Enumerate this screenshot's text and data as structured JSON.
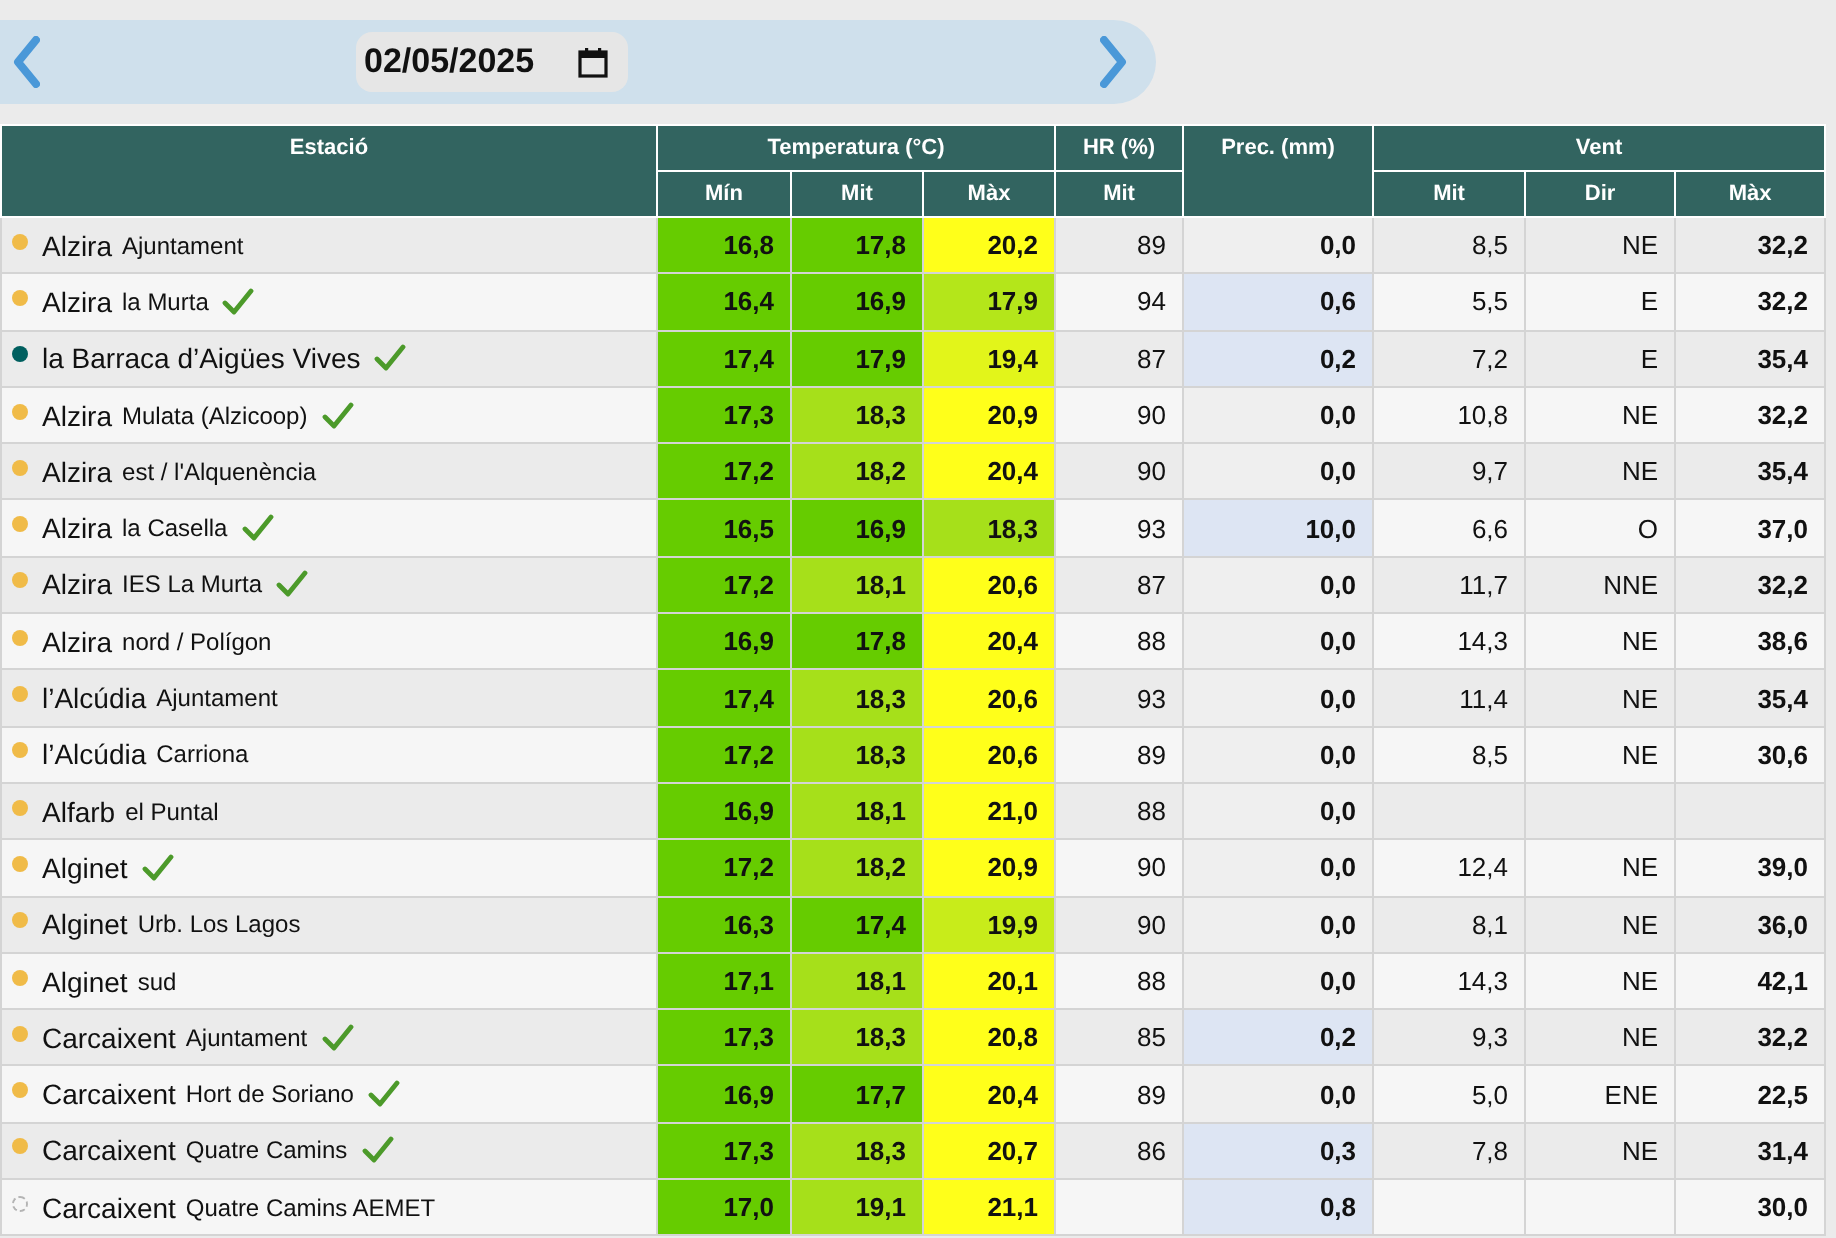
{
  "date_bar": {
    "date": "02/05/2025"
  },
  "header": {
    "station": "Estació",
    "temperature": "Temperatura (°C)",
    "temp_columns": [
      "Mín",
      "Mit",
      "Màx"
    ],
    "humidity": "HR (%)",
    "humidity_columns": [
      "Mit"
    ],
    "precipitation": "Prec. (mm)",
    "wind": "Vent",
    "wind_columns": [
      "Mit",
      "Dir",
      "Màx"
    ]
  },
  "rows": [
    {
      "town": "Alzira",
      "place": "Ajuntament",
      "color": "#f0bb48",
      "inactive": false,
      "verified": false,
      "temp": [
        {
          "value": "16,8",
          "color": "#66cc00"
        },
        {
          "value": "17,8",
          "color": "#66cc00"
        },
        {
          "value": "20,2",
          "color": "#ffff1a"
        }
      ],
      "hr": "89",
      "prec": {
        "value": "0,0",
        "highlight": false
      },
      "wind_avg": "8,5",
      "wind_dir": "NE",
      "wind_max": "32,2"
    },
    {
      "town": "Alzira",
      "place": "la Murta",
      "color": "#f0bb48",
      "inactive": false,
      "verified": true,
      "temp": [
        {
          "value": "16,4",
          "color": "#66cc00"
        },
        {
          "value": "16,9",
          "color": "#66cc00"
        },
        {
          "value": "17,9",
          "color": "#b4e61a"
        }
      ],
      "hr": "94",
      "prec": {
        "value": "0,6",
        "highlight": true
      },
      "wind_avg": "5,5",
      "wind_dir": "E",
      "wind_max": "32,2"
    },
    {
      "town": "la Barraca d’Aigües Vives",
      "color": "#005f5f",
      "inactive": false,
      "verified": true,
      "temp": [
        {
          "value": "17,4",
          "color": "#66cc00"
        },
        {
          "value": "17,9",
          "color": "#66cc00"
        },
        {
          "value": "19,4",
          "color": "#e2f51a"
        }
      ],
      "hr": "87",
      "prec": {
        "value": "0,2",
        "highlight": true
      },
      "wind_avg": "7,2",
      "wind_dir": "E",
      "wind_max": "35,4"
    },
    {
      "town": "Alzira",
      "place": "Mulata (Alzicoop)",
      "color": "#f0bb48",
      "inactive": false,
      "verified": true,
      "temp": [
        {
          "value": "17,3",
          "color": "#66cc00"
        },
        {
          "value": "18,3",
          "color": "#a6e01a"
        },
        {
          "value": "20,9",
          "color": "#ffff1a"
        }
      ],
      "hr": "90",
      "prec": {
        "value": "0,0",
        "highlight": false
      },
      "wind_avg": "10,8",
      "wind_dir": "NE",
      "wind_max": "32,2"
    },
    {
      "town": "Alzira",
      "place": "est / l'Alquenència",
      "color": "#f0bb48",
      "inactive": false,
      "verified": false,
      "temp": [
        {
          "value": "17,2",
          "color": "#66cc00"
        },
        {
          "value": "18,2",
          "color": "#a6e01a"
        },
        {
          "value": "20,4",
          "color": "#ffff1a"
        }
      ],
      "hr": "90",
      "prec": {
        "value": "0,0",
        "highlight": false
      },
      "wind_avg": "9,7",
      "wind_dir": "NE",
      "wind_max": "35,4"
    },
    {
      "town": "Alzira",
      "place": "la Casella",
      "color": "#f0bb48",
      "inactive": false,
      "verified": true,
      "temp": [
        {
          "value": "16,5",
          "color": "#66cc00"
        },
        {
          "value": "16,9",
          "color": "#66cc00"
        },
        {
          "value": "18,3",
          "color": "#a6e01a"
        }
      ],
      "hr": "93",
      "prec": {
        "value": "10,0",
        "highlight": true
      },
      "wind_avg": "6,6",
      "wind_dir": "O",
      "wind_max": "37,0"
    },
    {
      "town": "Alzira",
      "place": "IES La Murta",
      "color": "#f0bb48",
      "inactive": false,
      "verified": true,
      "temp": [
        {
          "value": "17,2",
          "color": "#66cc00"
        },
        {
          "value": "18,1",
          "color": "#a6e01a"
        },
        {
          "value": "20,6",
          "color": "#ffff1a"
        }
      ],
      "hr": "87",
      "prec": {
        "value": "0,0",
        "highlight": false
      },
      "wind_avg": "11,7",
      "wind_dir": "NNE",
      "wind_max": "32,2"
    },
    {
      "town": "Alzira",
      "place": "nord / Polígon",
      "color": "#f0bb48",
      "inactive": false,
      "verified": false,
      "temp": [
        {
          "value": "16,9",
          "color": "#66cc00"
        },
        {
          "value": "17,8",
          "color": "#66cc00"
        },
        {
          "value": "20,4",
          "color": "#ffff1a"
        }
      ],
      "hr": "88",
      "prec": {
        "value": "0,0",
        "highlight": false
      },
      "wind_avg": "14,3",
      "wind_dir": "NE",
      "wind_max": "38,6"
    },
    {
      "town": "l’Alcúdia",
      "place": "Ajuntament",
      "color": "#f0bb48",
      "inactive": false,
      "verified": false,
      "temp": [
        {
          "value": "17,4",
          "color": "#66cc00"
        },
        {
          "value": "18,3",
          "color": "#a6e01a"
        },
        {
          "value": "20,6",
          "color": "#ffff1a"
        }
      ],
      "hr": "93",
      "prec": {
        "value": "0,0",
        "highlight": false
      },
      "wind_avg": "11,4",
      "wind_dir": "NE",
      "wind_max": "35,4"
    },
    {
      "town": "l’Alcúdia",
      "place": "Carriona",
      "color": "#f0bb48",
      "inactive": false,
      "verified": false,
      "temp": [
        {
          "value": "17,2",
          "color": "#66cc00"
        },
        {
          "value": "18,3",
          "color": "#a6e01a"
        },
        {
          "value": "20,6",
          "color": "#ffff1a"
        }
      ],
      "hr": "89",
      "prec": {
        "value": "0,0",
        "highlight": false
      },
      "wind_avg": "8,5",
      "wind_dir": "NE",
      "wind_max": "30,6"
    },
    {
      "town": "Alfarb",
      "place": "el Puntal",
      "color": "#f0bb48",
      "inactive": false,
      "verified": false,
      "temp": [
        {
          "value": "16,9",
          "color": "#66cc00"
        },
        {
          "value": "18,1",
          "color": "#a6e01a"
        },
        {
          "value": "21,0",
          "color": "#ffff1a"
        }
      ],
      "hr": "88",
      "prec": {
        "value": "0,0",
        "highlight": false
      }
    },
    {
      "town": "Alginet",
      "color": "#f0bb48",
      "inactive": false,
      "verified": true,
      "temp": [
        {
          "value": "17,2",
          "color": "#66cc00"
        },
        {
          "value": "18,2",
          "color": "#a6e01a"
        },
        {
          "value": "20,9",
          "color": "#ffff1a"
        }
      ],
      "hr": "90",
      "prec": {
        "value": "0,0",
        "highlight": false
      },
      "wind_avg": "12,4",
      "wind_dir": "NE",
      "wind_max": "39,0"
    },
    {
      "town": "Alginet",
      "place": "Urb. Los Lagos",
      "color": "#f0bb48",
      "inactive": false,
      "verified": false,
      "temp": [
        {
          "value": "16,3",
          "color": "#66cc00"
        },
        {
          "value": "17,4",
          "color": "#66cc00"
        },
        {
          "value": "19,9",
          "color": "#c8ec1a"
        }
      ],
      "hr": "90",
      "prec": {
        "value": "0,0",
        "highlight": false
      },
      "wind_avg": "8,1",
      "wind_dir": "NE",
      "wind_max": "36,0"
    },
    {
      "town": "Alginet",
      "place": "sud",
      "color": "#f0bb48",
      "inactive": false,
      "verified": false,
      "temp": [
        {
          "value": "17,1",
          "color": "#66cc00"
        },
        {
          "value": "18,1",
          "color": "#a6e01a"
        },
        {
          "value": "20,1",
          "color": "#ffff1a"
        }
      ],
      "hr": "88",
      "prec": {
        "value": "0,0",
        "highlight": false
      },
      "wind_avg": "14,3",
      "wind_dir": "NE",
      "wind_max": "42,1"
    },
    {
      "town": "Carcaixent",
      "place": "Ajuntament",
      "color": "#f0bb48",
      "inactive": false,
      "verified": true,
      "temp": [
        {
          "value": "17,3",
          "color": "#66cc00"
        },
        {
          "value": "18,3",
          "color": "#a6e01a"
        },
        {
          "value": "20,8",
          "color": "#ffff1a"
        }
      ],
      "hr": "85",
      "prec": {
        "value": "0,2",
        "highlight": true
      },
      "wind_avg": "9,3",
      "wind_dir": "NE",
      "wind_max": "32,2"
    },
    {
      "town": "Carcaixent",
      "place": "Hort de Soriano",
      "color": "#f0bb48",
      "inactive": false,
      "verified": true,
      "temp": [
        {
          "value": "16,9",
          "color": "#66cc00"
        },
        {
          "value": "17,7",
          "color": "#66cc00"
        },
        {
          "value": "20,4",
          "color": "#ffff1a"
        }
      ],
      "hr": "89",
      "prec": {
        "value": "0,0",
        "highlight": false
      },
      "wind_avg": "5,0",
      "wind_dir": "ENE",
      "wind_max": "22,5"
    },
    {
      "town": "Carcaixent",
      "place": "Quatre Camins",
      "color": "#f0bb48",
      "inactive": false,
      "verified": true,
      "temp": [
        {
          "value": "17,3",
          "color": "#66cc00"
        },
        {
          "value": "18,3",
          "color": "#a6e01a"
        },
        {
          "value": "20,7",
          "color": "#ffff1a"
        }
      ],
      "hr": "86",
      "prec": {
        "value": "0,3",
        "highlight": true
      },
      "wind_avg": "7,8",
      "wind_dir": "NE",
      "wind_max": "31,4"
    },
    {
      "town": "Carcaixent",
      "place": "Quatre Camins AEMET",
      "color": "#b4b4b4",
      "inactive": true,
      "verified": false,
      "temp": [
        {
          "value": "17,0",
          "color": "#66cc00"
        },
        {
          "value": "19,1",
          "color": "#a6e01a"
        },
        {
          "value": "21,1",
          "color": "#ffff1a"
        }
      ],
      "prec": {
        "value": "0,8",
        "highlight": true
      },
      "wind_max": "30,0"
    }
  ]
}
